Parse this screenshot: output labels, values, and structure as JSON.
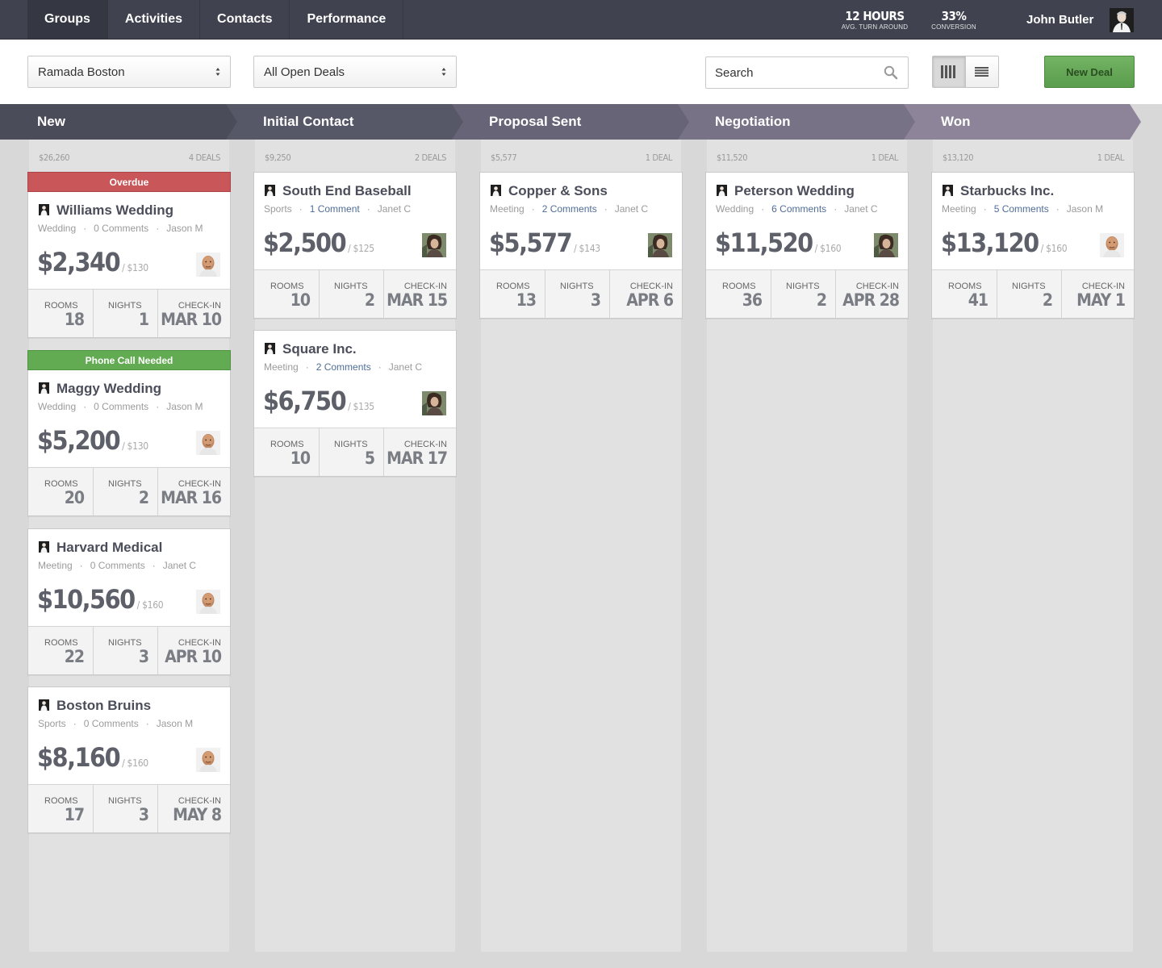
{
  "nav": {
    "tabs": [
      "Groups",
      "Activities",
      "Contacts",
      "Performance"
    ],
    "active_tab": "Groups",
    "stats": [
      {
        "value": "12 HOURS",
        "label": "AVG. TURN AROUND"
      },
      {
        "value": "33%",
        "label": "CONVERSION"
      }
    ],
    "user_name": "John Butler"
  },
  "toolbar": {
    "property_select": "Ramada Boston",
    "deals_select": "All Open Deals",
    "search_placeholder": "Search",
    "view_modes": [
      "columns-view-icon",
      "list-view-icon"
    ],
    "active_view": "columns-view-icon",
    "new_deal_label": "New Deal"
  },
  "colors": {
    "nav_bg": "#40434f",
    "overdue": "#c9575a",
    "phone_call": "#63ab53",
    "new_deal_button": "#5a9d4c",
    "link": "#4f6e98"
  },
  "footer_labels": {
    "rooms": "ROOMS",
    "nights": "NIGHTS",
    "checkin": "CHECK-IN"
  },
  "columns": [
    {
      "stage": "New",
      "stage_color": "#4a4c5a",
      "total": "$26,260",
      "count": "4 DEALS",
      "cards": [
        {
          "banner": "Overdue",
          "banner_type": "red",
          "title": "Williams Wedding",
          "type": "Wedding",
          "comments": "0 Comments",
          "comments_link": false,
          "owner": "Jason M",
          "price": "$2,340",
          "rate": "/ $130",
          "avatar": "man-avatar",
          "rooms": "18",
          "nights": "1",
          "checkin": "MAR 10"
        },
        {
          "banner": "Phone Call Needed",
          "banner_type": "green",
          "title": "Maggy Wedding",
          "type": "Wedding",
          "comments": "0 Comments",
          "comments_link": false,
          "owner": "Jason M",
          "price": "$5,200",
          "rate": "/ $130",
          "avatar": "man-avatar",
          "rooms": "20",
          "nights": "2",
          "checkin": "MAR 16"
        },
        {
          "banner": null,
          "title": "Harvard Medical",
          "type": "Meeting",
          "comments": "0 Comments",
          "comments_link": false,
          "owner": "Janet C",
          "price": "$10,560",
          "rate": "/ $160",
          "avatar": "man-avatar",
          "rooms": "22",
          "nights": "3",
          "checkin": "APR 10"
        },
        {
          "banner": null,
          "title": "Boston Bruins",
          "type": "Sports",
          "comments": "0 Comments",
          "comments_link": false,
          "owner": "Jason M",
          "price": "$8,160",
          "rate": "/ $160",
          "avatar": "man-avatar",
          "rooms": "17",
          "nights": "3",
          "checkin": "MAY 8"
        }
      ]
    },
    {
      "stage": "Initial Contact",
      "stage_color": "#565868",
      "total": "$9,250",
      "count": "2 DEALS",
      "cards": [
        {
          "banner": null,
          "title": "South End Baseball",
          "type": "Sports",
          "comments": "1 Comment",
          "comments_link": true,
          "owner": "Janet C",
          "price": "$2,500",
          "rate": "/ $125",
          "avatar": "woman-avatar",
          "rooms": "10",
          "nights": "2",
          "checkin": "MAR 15"
        },
        {
          "banner": null,
          "title": "Square Inc.",
          "type": "Meeting",
          "comments": "2 Comments",
          "comments_link": true,
          "owner": "Janet C",
          "price": "$6,750",
          "rate": "/ $135",
          "avatar": "woman-avatar",
          "rooms": "10",
          "nights": "5",
          "checkin": "MAR 17"
        }
      ]
    },
    {
      "stage": "Proposal Sent",
      "stage_color": "#666476",
      "total": "$5,577",
      "count": "1 DEAL",
      "cards": [
        {
          "banner": null,
          "title": "Copper & Sons",
          "type": "Meeting",
          "comments": "2 Comments",
          "comments_link": true,
          "owner": "Janet C",
          "price": "$5,577",
          "rate": "/ $143",
          "avatar": "woman-avatar",
          "rooms": "13",
          "nights": "3",
          "checkin": "APR 6"
        }
      ]
    },
    {
      "stage": "Negotiation",
      "stage_color": "#787287",
      "total": "$11,520",
      "count": "1 DEAL",
      "cards": [
        {
          "banner": null,
          "title": "Peterson Wedding",
          "type": "Wedding",
          "comments": "6 Comments",
          "comments_link": true,
          "owner": "Janet C",
          "price": "$11,520",
          "rate": "/ $160",
          "avatar": "woman-avatar",
          "rooms": "36",
          "nights": "2",
          "checkin": "APR 28"
        }
      ]
    },
    {
      "stage": "Won",
      "stage_color": "#8d8499",
      "total": "$13,120",
      "count": "1 DEAL",
      "cards": [
        {
          "banner": null,
          "title": "Starbucks Inc.",
          "type": "Meeting",
          "comments": "5 Comments",
          "comments_link": true,
          "owner": "Jason M",
          "price": "$13,120",
          "rate": "/ $160",
          "avatar": "man-avatar",
          "rooms": "41",
          "nights": "2",
          "checkin": "MAY 1"
        }
      ]
    }
  ]
}
